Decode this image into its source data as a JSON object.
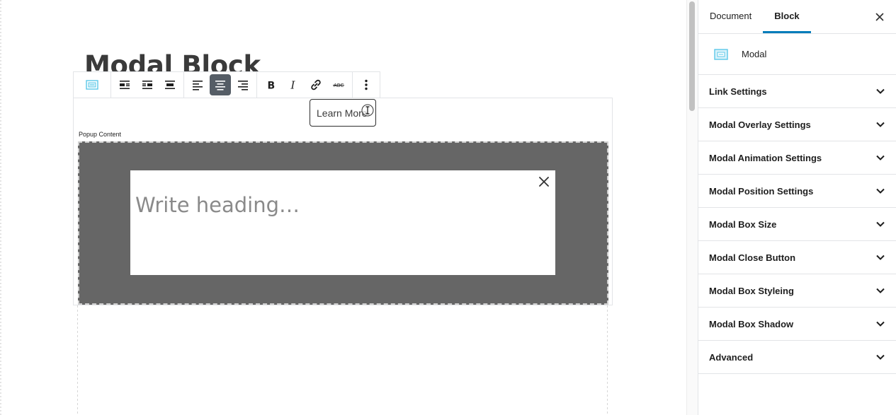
{
  "editor": {
    "post_title": "Modal Block",
    "toolbar": {
      "items": [
        {
          "icon": "modal-block-icon"
        },
        {
          "icon": "align-wide-left-icon"
        },
        {
          "icon": "align-wide-right-icon"
        },
        {
          "icon": "align-full-icon"
        },
        {
          "icon": "text-align-left-icon"
        },
        {
          "icon": "text-align-center-icon",
          "active": true
        },
        {
          "icon": "text-align-right-icon"
        },
        {
          "icon": "bold-icon"
        },
        {
          "icon": "italic-icon"
        },
        {
          "icon": "link-icon"
        },
        {
          "icon": "strikethrough-icon"
        },
        {
          "icon": "more-options-icon"
        }
      ]
    },
    "trigger_button": "Learn More",
    "popup_label": "Popup Content",
    "modal": {
      "heading_placeholder": "Write heading…",
      "overlay_color": "#666666"
    }
  },
  "sidebar": {
    "tabs": [
      {
        "label": "Document",
        "active": false
      },
      {
        "label": "Block",
        "active": true
      }
    ],
    "block_name": "Modal",
    "panels": [
      {
        "title": "Link Settings"
      },
      {
        "title": "Modal Overlay Settings"
      },
      {
        "title": "Modal Animation Settings"
      },
      {
        "title": "Modal Position Settings"
      },
      {
        "title": "Modal Box Size"
      },
      {
        "title": "Modal Close Button"
      },
      {
        "title": "Modal Box Styleing"
      },
      {
        "title": "Modal Box Shadow"
      },
      {
        "title": "Advanced"
      }
    ]
  },
  "colors": {
    "accent": "#007cba",
    "toolbar_active": "#555d66",
    "block_icon": "#5bc8e8"
  }
}
